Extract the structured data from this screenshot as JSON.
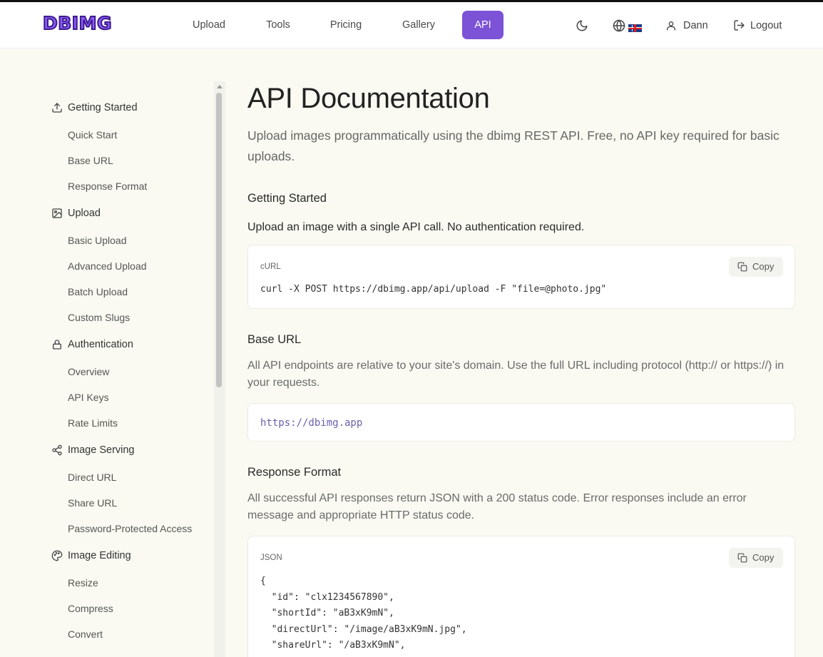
{
  "brand": {
    "logo": "DBIMG"
  },
  "nav": {
    "items": [
      {
        "label": "Upload"
      },
      {
        "label": "Tools"
      },
      {
        "label": "Pricing"
      },
      {
        "label": "Gallery"
      },
      {
        "label": "API",
        "active": true
      }
    ],
    "user_name": "Dann",
    "logout_label": "Logout",
    "language_icon": "globe-icon",
    "theme_icon": "moon-icon",
    "accent_color": "#7c52d6"
  },
  "sidebar": {
    "groups": [
      {
        "label": "Getting Started",
        "icon": "upload-icon",
        "items": [
          "Quick Start",
          "Base URL",
          "Response Format"
        ]
      },
      {
        "label": "Upload",
        "icon": "image-icon",
        "items": [
          "Basic Upload",
          "Advanced Upload",
          "Batch Upload",
          "Custom Slugs"
        ]
      },
      {
        "label": "Authentication",
        "icon": "lock-icon",
        "items": [
          "Overview",
          "API Keys",
          "Rate Limits"
        ]
      },
      {
        "label": "Image Serving",
        "icon": "share-icon",
        "items": [
          "Direct URL",
          "Share URL",
          "Password-Protected Access"
        ]
      },
      {
        "label": "Image Editing",
        "icon": "palette-icon",
        "items": [
          "Resize",
          "Compress",
          "Convert"
        ]
      }
    ]
  },
  "main": {
    "title": "API Documentation",
    "lead": "Upload images programmatically using the dbimg REST API. Free, no API key required for basic uploads.",
    "sections": {
      "getting_started": {
        "heading": "Getting Started",
        "text": "Upload an image with a single API call. No authentication required.",
        "code_lang": "cURL",
        "code": "curl -X POST https://dbimg.app/api/upload -F \"file=@photo.jpg\"",
        "copy_label": "Copy"
      },
      "base_url": {
        "heading": "Base URL",
        "text": "All API endpoints are relative to your site's domain. Use the full URL including protocol (http:// or https://) in your requests.",
        "code": "https://dbimg.app"
      },
      "response_format": {
        "heading": "Response Format",
        "text": "All successful API responses return JSON with a 200 status code. Error responses include an error message and appropriate HTTP status code.",
        "code_lang": "JSON",
        "code": "{\n  \"id\": \"clx1234567890\",\n  \"shortId\": \"aB3xK9mN\",\n  \"directUrl\": \"/image/aB3xK9mN.jpg\",\n  \"shareUrl\": \"/aB3xK9mN\",\n  \"fileName\": \"photo.jpg\",",
        "copy_label": "Copy"
      }
    }
  }
}
